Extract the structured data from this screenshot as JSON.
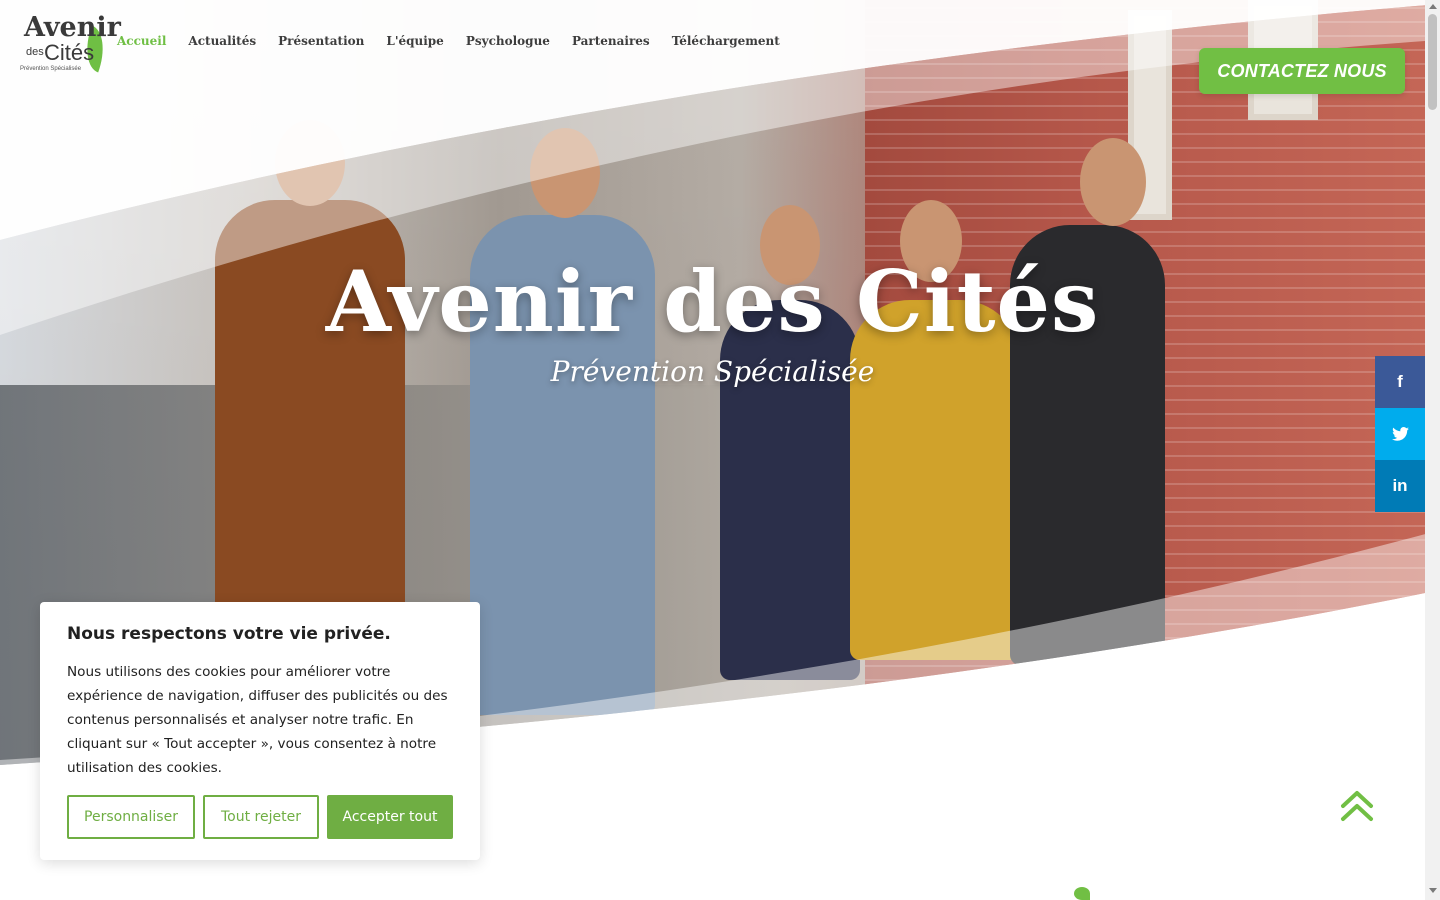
{
  "header": {
    "logo": {
      "line1": "Avenir",
      "des": "des",
      "line2": "Cités",
      "tagline": "Prévention Spécialisée"
    },
    "nav": [
      {
        "label": "Accueil",
        "active": true
      },
      {
        "label": "Actualités"
      },
      {
        "label": "Présentation"
      },
      {
        "label": "L'équipe"
      },
      {
        "label": "Psychologue"
      },
      {
        "label": "Partenaires"
      },
      {
        "label": "Téléchargement"
      }
    ],
    "cta_label": "CONTACTEZ NOUS"
  },
  "hero": {
    "title": "Avenir des Cités",
    "subtitle": "Prévention Spécialisée"
  },
  "social": [
    {
      "name": "facebook-icon",
      "glyph": "f"
    },
    {
      "name": "twitter-icon",
      "glyph": "🐦"
    },
    {
      "name": "linkedin-icon",
      "glyph": "in"
    }
  ],
  "cookie": {
    "title": "Nous respectons votre vie privée.",
    "text": "Nous utilisons des cookies pour améliorer votre expérience de navigation, diffuser des publicités ou des contenus personnalisés et analyser notre trafic. En cliquant sur « Tout accepter », vous consentez à notre utilisation des cookies.",
    "customize_label": "Personnaliser",
    "reject_label": "Tout rejeter",
    "accept_label": "Accepter tout"
  },
  "colors": {
    "accent_green": "#71bf44",
    "brand_magenta": "#b0316e",
    "facebook": "#3b5998",
    "twitter": "#00aced",
    "linkedin": "#007bb6"
  }
}
